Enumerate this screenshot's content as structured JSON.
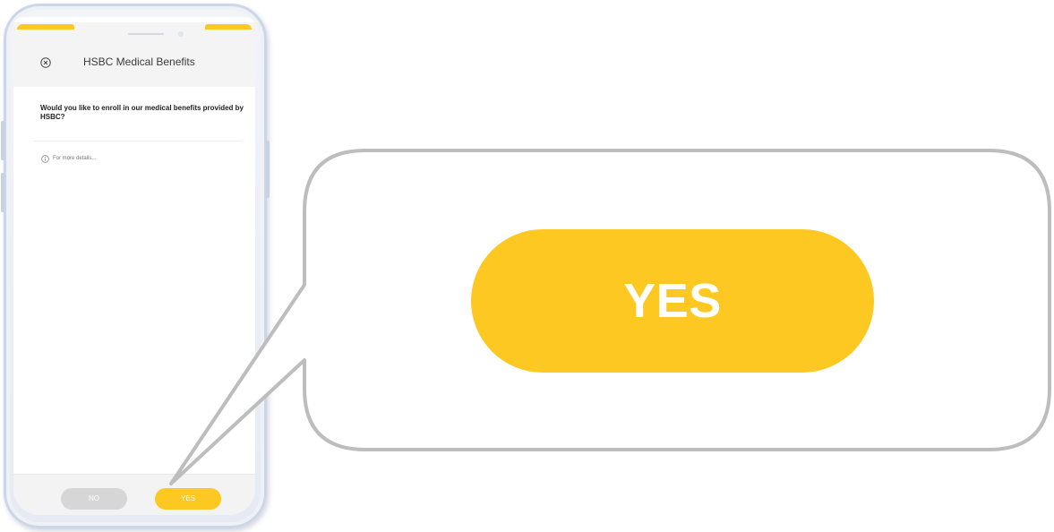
{
  "app": {
    "header_title": "HSBC Medical Benefits",
    "close_icon": "close-circle-icon"
  },
  "content": {
    "question": "Would you like to enroll in our medical benefits provided by HSBC?",
    "info_icon": "info-circle-icon",
    "info_link": "For more details..."
  },
  "footer": {
    "no_label": "NO",
    "yes_label": "YES"
  },
  "callout": {
    "zoomed_label": "YES"
  },
  "colors": {
    "accent": "#fcc821",
    "disabled": "#d6d6d6",
    "header_bg": "#f4f4f4",
    "callout_border": "#bdbdbd"
  }
}
